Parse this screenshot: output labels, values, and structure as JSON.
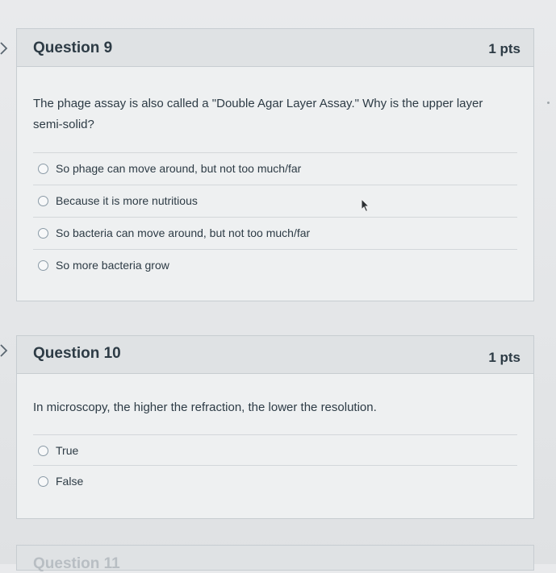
{
  "questions": [
    {
      "title": "Question 9",
      "points": "1 pts",
      "text": "The phage assay is also called a \"Double Agar Layer Assay.\" Why is the upper layer semi-solid?",
      "options": [
        "So phage can move around, but not too much/far",
        "Because it is more nutritious",
        "So bacteria can move around, but not too much/far",
        "So more bacteria grow"
      ]
    },
    {
      "title": "Question 10",
      "points": "1 pts",
      "text": "In microscopy, the higher the refraction, the lower the resolution.",
      "options": [
        "True",
        "False"
      ]
    }
  ],
  "next_question_peek": "Question 11",
  "icons": {
    "collapse": "chevron-right-icon",
    "pointer": "mouse-pointer-icon"
  }
}
